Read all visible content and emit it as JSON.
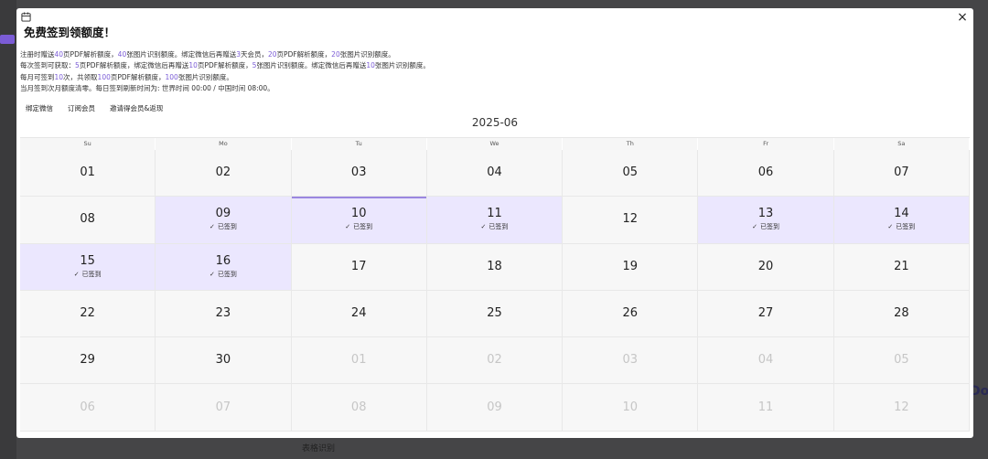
{
  "modal": {
    "title": "免费签到领额度！",
    "close": "×",
    "info_lines": [
      [
        {
          "t": "注册时赠送"
        },
        {
          "t": "40",
          "hl": true
        },
        {
          "t": "页PDF解析额度，"
        },
        {
          "t": "40",
          "hl": true
        },
        {
          "t": "张图片识别额度。绑定微信后再赠送"
        },
        {
          "t": "3",
          "hl": true
        },
        {
          "t": "天会员，"
        },
        {
          "t": "20",
          "hl": true
        },
        {
          "t": "页PDF解析额度，"
        },
        {
          "t": "20",
          "hl": true
        },
        {
          "t": "张图片识别额度。"
        }
      ],
      [
        {
          "t": "每次签到可获取："
        },
        {
          "t": "5",
          "hl": true
        },
        {
          "t": "页PDF解析额度，绑定微信后再赠送"
        },
        {
          "t": "10",
          "hl": true
        },
        {
          "t": "页PDF解析额度，"
        },
        {
          "t": "5",
          "hl": true
        },
        {
          "t": "张图片识别额度。绑定微信后再赠送"
        },
        {
          "t": "10",
          "hl": true
        },
        {
          "t": "张图片识别额度。"
        }
      ],
      [
        {
          "t": "每月可签到"
        },
        {
          "t": "10",
          "hl": true
        },
        {
          "t": "次，共领取"
        },
        {
          "t": "100",
          "hl": true
        },
        {
          "t": "页PDF解析额度，"
        },
        {
          "t": "100",
          "hl": true
        },
        {
          "t": "张图片识别额度。"
        }
      ],
      [
        {
          "t": "当月签到次月额度清零。每日签到刷新时间为: 世界时间 00:00 / 中国时间 08:00。"
        }
      ]
    ],
    "actions": [
      "绑定微信",
      "订阅会员",
      "邀请得会员&返现"
    ],
    "month_label": "2025-06",
    "weekdays": [
      "Su",
      "Mo",
      "Tu",
      "We",
      "Th",
      "Fr",
      "Sa"
    ],
    "signed_label": "已签到",
    "check_glyph": "✓",
    "days": [
      {
        "d": "01"
      },
      {
        "d": "02"
      },
      {
        "d": "03"
      },
      {
        "d": "04"
      },
      {
        "d": "05"
      },
      {
        "d": "06"
      },
      {
        "d": "07"
      },
      {
        "d": "08"
      },
      {
        "d": "09",
        "signed": true
      },
      {
        "d": "10",
        "signed": true,
        "today": true
      },
      {
        "d": "11",
        "signed": true
      },
      {
        "d": "12"
      },
      {
        "d": "13",
        "signed": true
      },
      {
        "d": "14",
        "signed": true
      },
      {
        "d": "15",
        "signed": true
      },
      {
        "d": "16",
        "signed": true
      },
      {
        "d": "17"
      },
      {
        "d": "18"
      },
      {
        "d": "19"
      },
      {
        "d": "20"
      },
      {
        "d": "21"
      },
      {
        "d": "22"
      },
      {
        "d": "23"
      },
      {
        "d": "24"
      },
      {
        "d": "25"
      },
      {
        "d": "26"
      },
      {
        "d": "27"
      },
      {
        "d": "28"
      },
      {
        "d": "29"
      },
      {
        "d": "30"
      },
      {
        "d": "01",
        "other": true
      },
      {
        "d": "02",
        "other": true
      },
      {
        "d": "03",
        "other": true
      },
      {
        "d": "04",
        "other": true
      },
      {
        "d": "05",
        "other": true
      },
      {
        "d": "06",
        "other": true
      },
      {
        "d": "07",
        "other": true
      },
      {
        "d": "08",
        "other": true
      },
      {
        "d": "09",
        "other": true
      },
      {
        "d": "10",
        "other": true
      },
      {
        "d": "11",
        "other": true
      },
      {
        "d": "12",
        "other": true
      }
    ]
  },
  "background": {
    "bottom_text": "表格识别",
    "right_text": "Do"
  }
}
